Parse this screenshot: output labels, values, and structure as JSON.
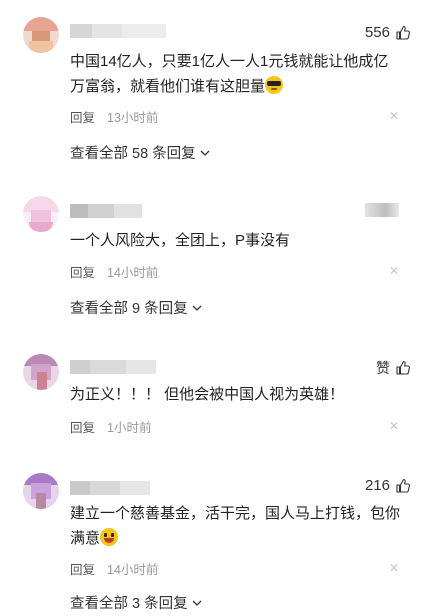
{
  "comments": [
    {
      "likes": "556",
      "text": "中国14亿人，只要1亿人一人1元钱就能让他成亿万富翁，就看他们谁有这胆量",
      "emoji": "sunglasses-emoji",
      "reply_label": "回复",
      "time": "13小时前",
      "view_all": "查看全部 58 条回复"
    },
    {
      "likes": "",
      "text": "一个人风险大，全团上，P事没有",
      "reply_label": "回复",
      "time": "14小时前",
      "view_all": "查看全部 9 条回复"
    },
    {
      "likes": "赞",
      "text": "为正义！！！ 但他会被中国人视为英雄！",
      "reply_label": "回复",
      "time": "1小时前",
      "view_all": ""
    },
    {
      "likes": "216",
      "text": "建立一个慈善基金，活干完，国人马上打钱，包你满意",
      "emoji": "grinning-emoji",
      "reply_label": "回复",
      "time": "14小时前",
      "view_all": "查看全部 3 条回复"
    }
  ],
  "icons": {
    "like": "thumbs-up-icon",
    "close": "close-icon",
    "chevron": "chevron-down-icon"
  },
  "colors": {
    "emoji_yellow": "#f5c518",
    "text_muted": "#999999"
  }
}
